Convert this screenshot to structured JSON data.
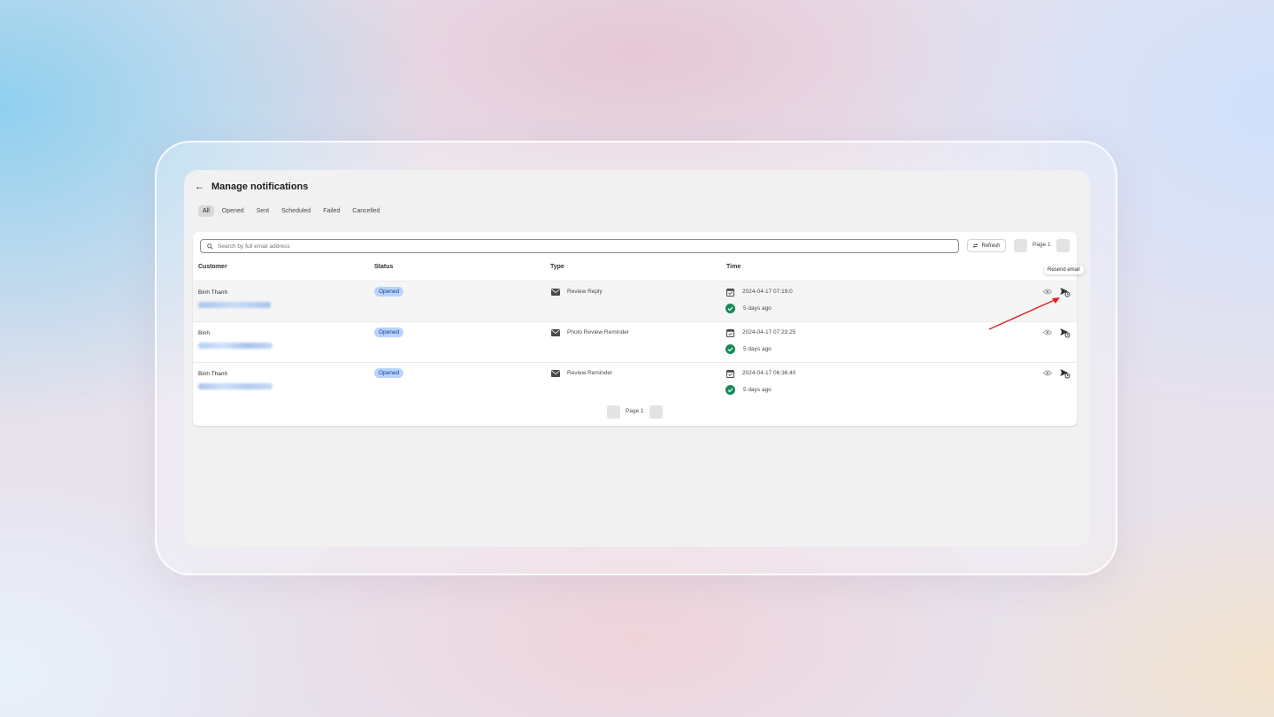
{
  "header": {
    "title": "Manage notifications"
  },
  "tabs": [
    {
      "label": "All",
      "active": true
    },
    {
      "label": "Opened"
    },
    {
      "label": "Sent"
    },
    {
      "label": "Scheduled"
    },
    {
      "label": "Failed"
    },
    {
      "label": "Cancelled"
    }
  ],
  "search": {
    "placeholder": "Search by full email address"
  },
  "toolbar": {
    "refresh_label": "Refresh",
    "page_label": "Page 1"
  },
  "columns": {
    "customer": "Customer",
    "status": "Status",
    "type": "Type",
    "time": "Time"
  },
  "rows": [
    {
      "customer": "Binh Thanh",
      "status": "Opened",
      "type": "Review Reply",
      "time": "2024-04-17 07:19:0",
      "ago": "5 days ago"
    },
    {
      "customer": "Binh",
      "status": "Opened",
      "type": "Photo Review Reminder",
      "time": "2024-04-17 07:23:25",
      "ago": "5 days ago"
    },
    {
      "customer": "Binh Thanh",
      "status": "Opened",
      "type": "Review Reminder",
      "time": "2024-04-17 06:36:40",
      "ago": "5 days ago"
    }
  ],
  "pagination": {
    "label": "Page 1"
  },
  "tooltip": {
    "text": "Resend email"
  },
  "colors": {
    "badge_bg": "#b8d3ff",
    "success": "#1a8a5a",
    "annotation_arrow": "#e02020"
  }
}
